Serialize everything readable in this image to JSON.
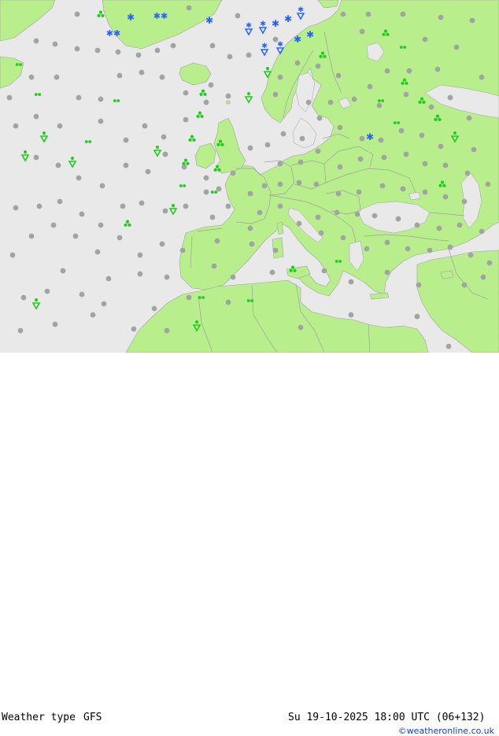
{
  "footer": {
    "product": "Weather type",
    "model": "GFS",
    "valid_time": "Su 19-10-2025 18:00 UTC (06+132)",
    "credit": "©weatheronline.co.uk"
  },
  "map": {
    "colors": {
      "sea": "#e9e9e9",
      "land": "#b8ef8c",
      "border": "#a0a0a0",
      "no_weather_dot": "#a3a3a3",
      "rain_green": "#1fcc1f",
      "snow_blue": "#2a62ff"
    },
    "symbol_legend": {
      "dot": "no significant weather",
      "drizzle": "light rain / drizzle",
      "showers": "rain showers",
      "shower-arrow": "shower",
      "snow": "snow",
      "snow-shower": "snow shower"
    }
  }
}
